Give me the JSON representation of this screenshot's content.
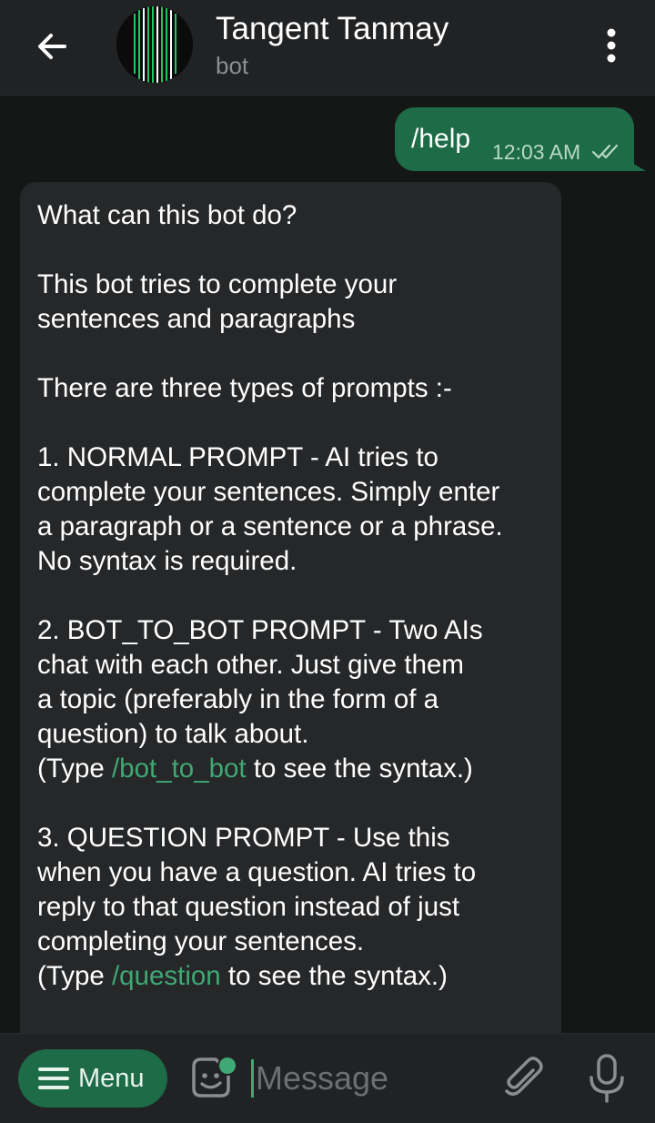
{
  "header": {
    "title": "Tangent Tanmay",
    "subtitle": "bot",
    "back_icon": "arrow-left-icon",
    "more_icon": "more-vertical-icon"
  },
  "messages": {
    "outgoing": {
      "text": "/help",
      "time": "12:03 AM",
      "status_icon": "double-check-icon"
    },
    "incoming": {
      "p1": "What can this bot do?",
      "p2": "This bot tries to complete your\nsentences and paragraphs",
      "p3": "There are three types of prompts :-",
      "p4": "1. NORMAL PROMPT - AI tries to\ncomplete your sentences. Simply enter\na paragraph or a sentence or a phrase.\nNo syntax is required.",
      "p5_main": "2. BOT_TO_BOT PROMPT - Two AIs\nchat with each other. Just give them\na topic (preferably in the form of a\nquestion) to talk about.",
      "p5_prefix": "(Type ",
      "p5_cmd": "/bot_to_bot",
      "p5_suffix": " to see the syntax.)",
      "p6_main": "3. QUESTION PROMPT - Use this\nwhen you have a question. AI tries to\nreply to that question instead of just\ncompleting your sentences.",
      "p6_prefix": "(Type ",
      "p6_cmd": "/question",
      "p6_suffix": " to see the syntax.)"
    }
  },
  "input_bar": {
    "menu_label": "Menu",
    "placeholder": "Message",
    "sticker_icon": "sticker-icon",
    "attach_icon": "paperclip-icon",
    "mic_icon": "microphone-icon"
  },
  "colors": {
    "accent": "#1e6b47",
    "link": "#3fa874",
    "background": "#151616",
    "bar": "#212224",
    "incoming_bubble": "#262729"
  }
}
